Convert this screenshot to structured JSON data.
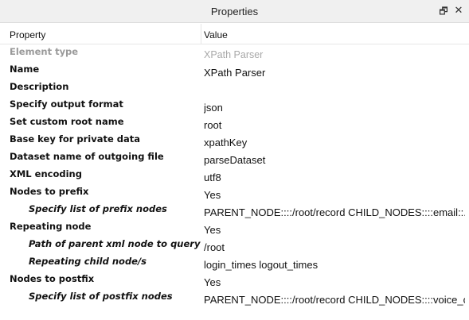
{
  "panel": {
    "title": "Properties",
    "float_icon": "restore-window-icon",
    "close_icon": "close-icon",
    "float_glyph": "🗗",
    "close_glyph": "✕"
  },
  "table": {
    "headers": {
      "property": "Property",
      "value": "Value"
    },
    "rows": [
      {
        "name": "Element type",
        "value": "XPath Parser",
        "level": 0,
        "muted": true
      },
      {
        "name": "Name",
        "value": "XPath Parser",
        "level": 0,
        "muted": false
      },
      {
        "name": "Description",
        "value": "",
        "level": 0,
        "muted": false
      },
      {
        "name": "Specify output format",
        "value": "json",
        "level": 0,
        "muted": false
      },
      {
        "name": "Set custom root name",
        "value": "root",
        "level": 0,
        "muted": false
      },
      {
        "name": "Base key for private data",
        "value": "xpathKey",
        "level": 0,
        "muted": false
      },
      {
        "name": "Dataset name of outgoing file",
        "value": "parseDataset",
        "level": 0,
        "muted": false
      },
      {
        "name": "XML encoding",
        "value": "utf8",
        "level": 0,
        "muted": false
      },
      {
        "name": "Nodes to prefix",
        "value": "Yes",
        "level": 0,
        "muted": false
      },
      {
        "name": "Specify list of prefix nodes",
        "value": "PARENT_NODE::::/root/record CHILD_NODES::::email::...",
        "level": 1,
        "muted": false
      },
      {
        "name": "Repeating node",
        "value": "Yes",
        "level": 0,
        "muted": false
      },
      {
        "name": "Path of parent xml node to query",
        "value": "/root",
        "level": 1,
        "muted": false
      },
      {
        "name": "Repeating child node/s",
        "value": "login_times logout_times",
        "level": 1,
        "muted": false
      },
      {
        "name": "Nodes to postfix",
        "value": "Yes",
        "level": 0,
        "muted": false
      },
      {
        "name": "Specify list of postfix nodes",
        "value": "PARENT_NODE::::/root/record CHILD_NODES::::voice_c...",
        "level": 1,
        "muted": false
      }
    ]
  }
}
